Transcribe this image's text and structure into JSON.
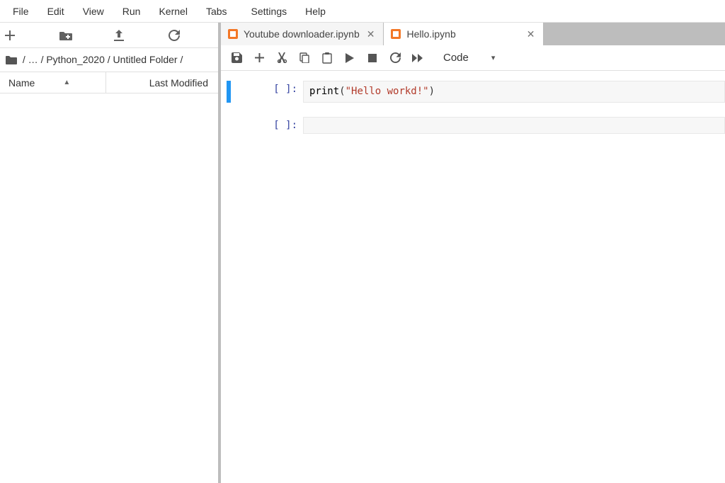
{
  "menu": {
    "items": [
      "File",
      "Edit",
      "View",
      "Run",
      "Kernel",
      "Tabs",
      "Settings",
      "Help"
    ]
  },
  "filebrowser": {
    "toolbar": {
      "new_label": "+",
      "new_folder_label": "new-folder",
      "upload_label": "upload",
      "refresh_label": "refresh"
    },
    "breadcrumb": {
      "root": "/",
      "ellipsis": "…",
      "sep": "/",
      "part1": "Python_2020",
      "part2": "Untitled Folder",
      "trailing": "/"
    },
    "columns": {
      "name": "Name",
      "modified": "Last Modified"
    }
  },
  "tabs": [
    {
      "label": "Youtube downloader.ipynb",
      "active": false
    },
    {
      "label": "Hello.ipynb",
      "active": true
    }
  ],
  "nb_toolbar": {
    "celltype_label": "Code"
  },
  "cells": [
    {
      "prompt": "[ ]:",
      "code_fn": "print",
      "code_open": "(",
      "code_str": "\"Hello workd!\"",
      "code_close": ")",
      "active": true
    },
    {
      "prompt": "[ ]:",
      "code_fn": "",
      "code_open": "",
      "code_str": "",
      "code_close": "",
      "active": false
    }
  ]
}
